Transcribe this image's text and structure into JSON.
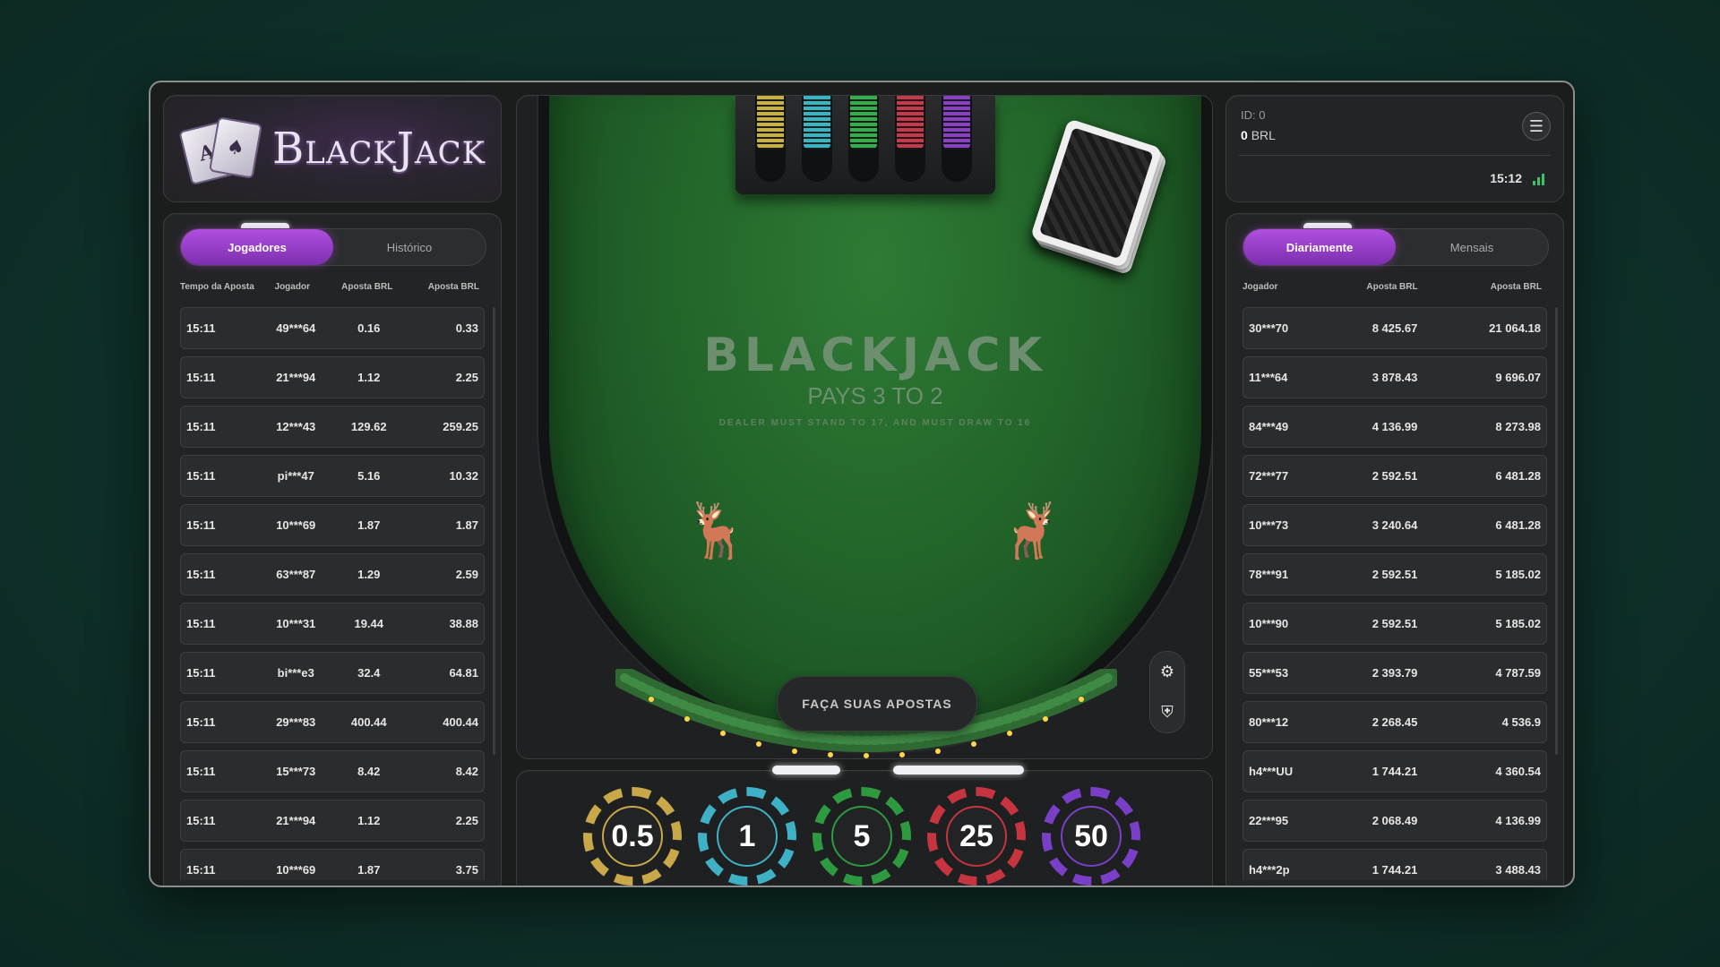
{
  "logo": {
    "text": "BlackJack",
    "card1": "A",
    "card2": "♠"
  },
  "left_panel": {
    "tabs": [
      {
        "label": "Jogadores",
        "active": true
      },
      {
        "label": "Histórico",
        "active": false
      }
    ],
    "columns": [
      "Tempo da Aposta",
      "Jogador",
      "Aposta BRL",
      "Aposta BRL"
    ],
    "rows": [
      [
        "15:11",
        "49***64",
        "0.16",
        "0.33"
      ],
      [
        "15:11",
        "21***94",
        "1.12",
        "2.25"
      ],
      [
        "15:11",
        "12***43",
        "129.62",
        "259.25"
      ],
      [
        "15:11",
        "pi***47",
        "5.16",
        "10.32"
      ],
      [
        "15:11",
        "10***69",
        "1.87",
        "1.87"
      ],
      [
        "15:11",
        "63***87",
        "1.29",
        "2.59"
      ],
      [
        "15:11",
        "10***31",
        "19.44",
        "38.88"
      ],
      [
        "15:11",
        "bi***e3",
        "32.4",
        "64.81"
      ],
      [
        "15:11",
        "29***83",
        "400.44",
        "400.44"
      ],
      [
        "15:11",
        "15***73",
        "8.42",
        "8.42"
      ],
      [
        "15:11",
        "21***94",
        "1.12",
        "2.25"
      ],
      [
        "15:11",
        "10***69",
        "1.87",
        "3.75"
      ]
    ]
  },
  "account": {
    "id": "ID: 0",
    "balance_value": "0",
    "balance_currency": "BRL",
    "time": "15:12",
    "menu_icon": "hamburger-icon"
  },
  "right_panel": {
    "tabs": [
      {
        "label": "Diariamente",
        "active": true
      },
      {
        "label": "Mensais",
        "active": false
      }
    ],
    "columns": [
      "Jogador",
      "Aposta BRL",
      "Aposta BRL"
    ],
    "rows": [
      [
        "30***70",
        "8 425.67",
        "21 064.18"
      ],
      [
        "11***64",
        "3 878.43",
        "9 696.07"
      ],
      [
        "84***49",
        "4 136.99",
        "8 273.98"
      ],
      [
        "72***77",
        "2 592.51",
        "6 481.28"
      ],
      [
        "10***73",
        "3 240.64",
        "6 481.28"
      ],
      [
        "78***91",
        "2 592.51",
        "5 185.02"
      ],
      [
        "10***90",
        "2 592.51",
        "5 185.02"
      ],
      [
        "55***53",
        "2 393.79",
        "4 787.59"
      ],
      [
        "80***12",
        "2 268.45",
        "4 536.9"
      ],
      [
        "h4***UU",
        "1 744.21",
        "4 360.54"
      ],
      [
        "22***95",
        "2 068.49",
        "4 136.99"
      ],
      [
        "h4***2p",
        "1 744.21",
        "3 488.43"
      ]
    ]
  },
  "table": {
    "title": "BLACKJACK",
    "subtitle": "PAYS 3 TO 2",
    "rule": "DEALER MUST STAND TO 17, AND MUST DRAW TO 16",
    "bet_prompt": "FAÇA SUAS APOSTAS",
    "tray_colors": [
      "#c9b23a",
      "#33b7c4",
      "#2fb04a",
      "#c9374a",
      "#8a3fc9"
    ]
  },
  "chips": [
    {
      "label": "0.5",
      "color": "#c9a84a"
    },
    {
      "label": "1",
      "color": "#3fb1c6"
    },
    {
      "label": "5",
      "color": "#2e9a40"
    },
    {
      "label": "25",
      "color": "#c5343f"
    },
    {
      "label": "50",
      "color": "#7a3fc7"
    }
  ],
  "colors": {
    "accent": "#9b3fd0",
    "felt": "#22652a",
    "signal": "#39c46a"
  }
}
